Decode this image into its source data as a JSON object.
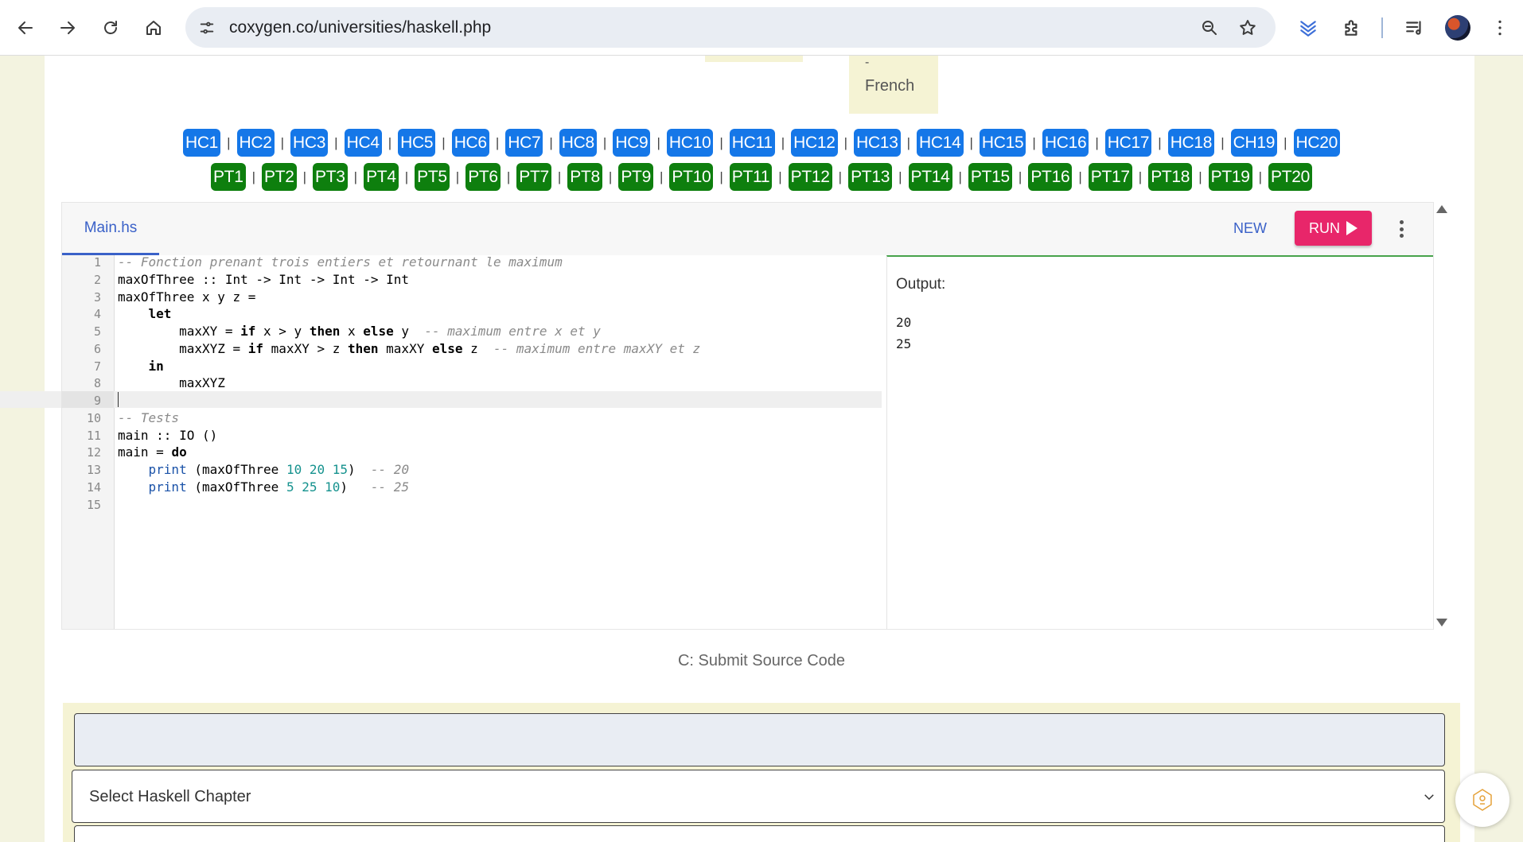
{
  "browser": {
    "url": "coxygen.co/universities/haskell.php"
  },
  "language_tab": {
    "dash": "-",
    "label": "French"
  },
  "hc_buttons": [
    "HC1",
    "HC2",
    "HC3",
    "HC4",
    "HC5",
    "HC6",
    "HC7",
    "HC8",
    "HC9",
    "HC10",
    "HC11",
    "HC12",
    "HC13",
    "HC14",
    "HC15",
    "HC16",
    "HC17",
    "HC18",
    "CH19",
    "HC20"
  ],
  "pt_buttons": [
    "PT1",
    "PT2",
    "PT3",
    "PT4",
    "PT5",
    "PT6",
    "PT7",
    "PT8",
    "PT9",
    "PT10",
    "PT11",
    "PT12",
    "PT13",
    "PT14",
    "PT15",
    "PT16",
    "PT17",
    "PT18",
    "PT19",
    "PT20"
  ],
  "separator": "|",
  "editor": {
    "file_tab": "Main.hs",
    "new_label": "NEW",
    "run_label": "RUN",
    "line_numbers": [
      "1",
      "2",
      "3",
      "4",
      "5",
      "6",
      "7",
      "8",
      "9",
      "10",
      "11",
      "12",
      "13",
      "14",
      "15"
    ],
    "code_lines": [
      [
        {
          "c": "c",
          "t": "-- Fonction prenant trois entiers et retournant le maximum"
        }
      ],
      [
        {
          "c": "t",
          "t": "maxOfThree :: Int -> Int -> Int -> Int"
        }
      ],
      [
        {
          "c": "t",
          "t": "maxOfThree x y z ="
        }
      ],
      [
        {
          "c": "t",
          "t": "    "
        },
        {
          "c": "k",
          "t": "let"
        }
      ],
      [
        {
          "c": "t",
          "t": "        maxXY = "
        },
        {
          "c": "k",
          "t": "if"
        },
        {
          "c": "t",
          "t": " x > y "
        },
        {
          "c": "k",
          "t": "then"
        },
        {
          "c": "t",
          "t": " x "
        },
        {
          "c": "k",
          "t": "else"
        },
        {
          "c": "t",
          "t": " y  "
        },
        {
          "c": "c",
          "t": "-- maximum entre x et y"
        }
      ],
      [
        {
          "c": "t",
          "t": "        maxXYZ = "
        },
        {
          "c": "k",
          "t": "if"
        },
        {
          "c": "t",
          "t": " maxXY > z "
        },
        {
          "c": "k",
          "t": "then"
        },
        {
          "c": "t",
          "t": " maxXY "
        },
        {
          "c": "k",
          "t": "else"
        },
        {
          "c": "t",
          "t": " z  "
        },
        {
          "c": "c",
          "t": "-- maximum entre maxXY et z"
        }
      ],
      [
        {
          "c": "t",
          "t": "    "
        },
        {
          "c": "k",
          "t": "in"
        }
      ],
      [
        {
          "c": "t",
          "t": "        maxXYZ"
        }
      ],
      [
        {
          "c": "t",
          "t": ""
        }
      ],
      [
        {
          "c": "c",
          "t": "-- Tests"
        }
      ],
      [
        {
          "c": "t",
          "t": "main :: IO ()"
        }
      ],
      [
        {
          "c": "t",
          "t": "main = "
        },
        {
          "c": "k",
          "t": "do"
        }
      ],
      [
        {
          "c": "t",
          "t": "    "
        },
        {
          "c": "f",
          "t": "print"
        },
        {
          "c": "t",
          "t": " (maxOfThree "
        },
        {
          "c": "n",
          "t": "10 20 15"
        },
        {
          "c": "t",
          "t": ")  "
        },
        {
          "c": "c",
          "t": "-- 20"
        }
      ],
      [
        {
          "c": "t",
          "t": "    "
        },
        {
          "c": "f",
          "t": "print"
        },
        {
          "c": "t",
          "t": " (maxOfThree "
        },
        {
          "c": "n",
          "t": "5 25 10"
        },
        {
          "c": "t",
          "t": ")   "
        },
        {
          "c": "c",
          "t": "-- 25"
        }
      ],
      [
        {
          "c": "t",
          "t": ""
        }
      ]
    ],
    "output_label": "Output:",
    "output_lines": [
      "20",
      "25"
    ]
  },
  "submit": {
    "title": "C: Submit Source Code",
    "select_value": "Select Haskell Chapter"
  },
  "colors": {
    "hc_button": "#1577e8",
    "pt_button": "#0e7f0e",
    "run_button": "#e8266a",
    "accent": "#3a61c8",
    "background": "#f3f3e0"
  }
}
